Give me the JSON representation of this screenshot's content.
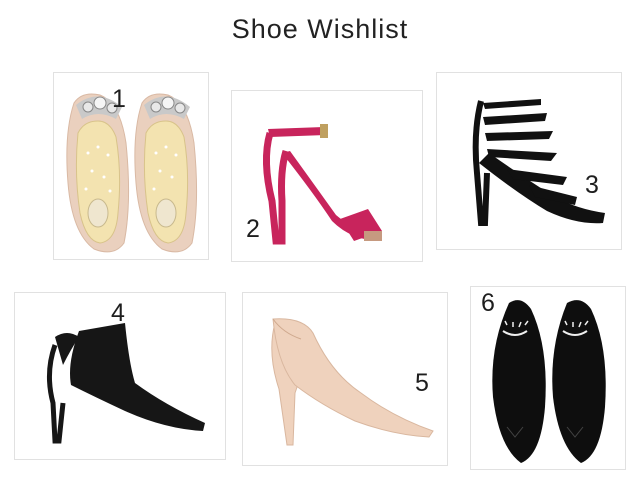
{
  "page": {
    "title": "Shoe Wishlist"
  },
  "items": [
    {
      "number": "1",
      "icon": "embellished-ballet-flats-icon",
      "color": "#ead0be"
    },
    {
      "number": "2",
      "icon": "pink-strappy-heel-sandal-icon",
      "color": "#c8245c"
    },
    {
      "number": "3",
      "icon": "black-caged-pointed-heel-icon",
      "color": "#111111"
    },
    {
      "number": "4",
      "icon": "black-slingback-pointed-heel-icon",
      "color": "#161616"
    },
    {
      "number": "5",
      "icon": "nude-pointed-court-shoe-icon",
      "color": "#efd2bd"
    },
    {
      "number": "6",
      "icon": "black-lash-pointed-flats-icon",
      "color": "#0e0e0e"
    }
  ]
}
